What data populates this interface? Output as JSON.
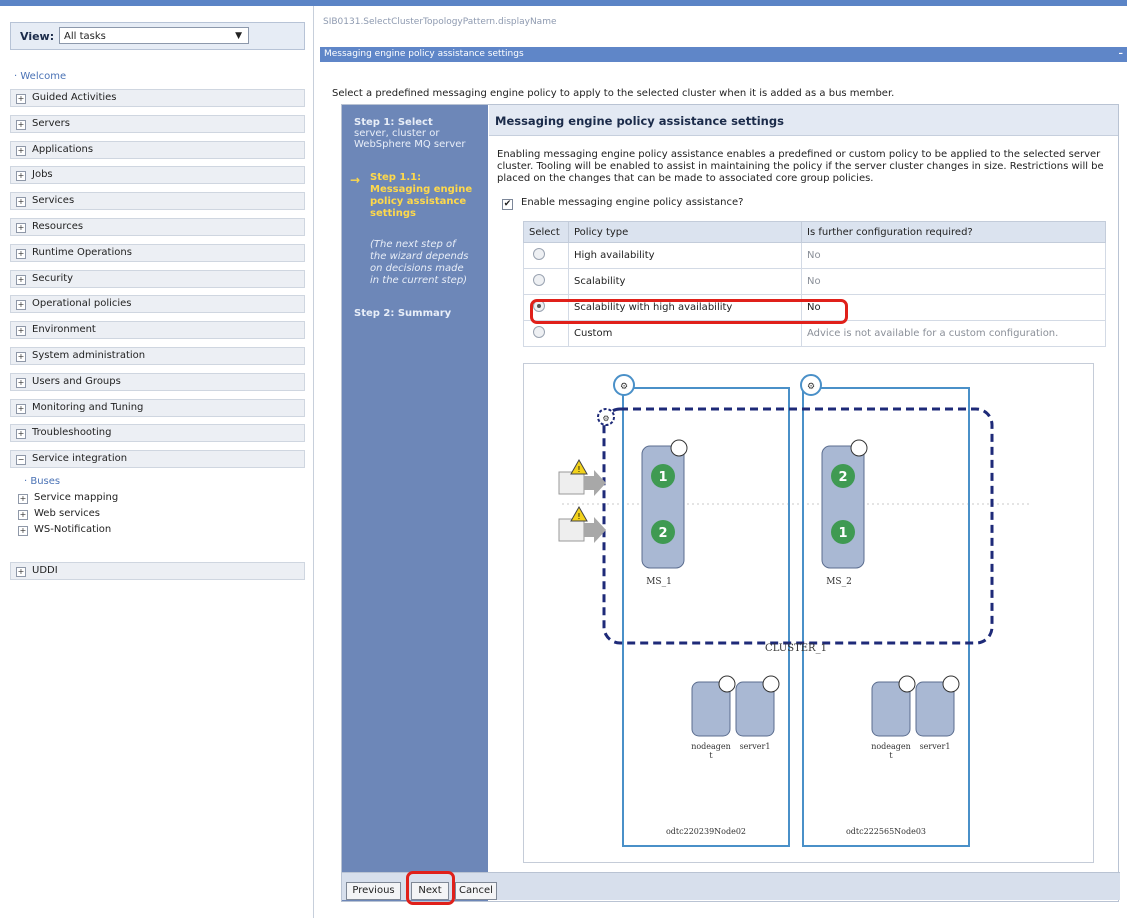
{
  "nav": {
    "view_label": "View:",
    "view_value": "All tasks",
    "welcome": "Welcome",
    "items_top": [
      "Guided Activities",
      "Servers",
      "Applications",
      "Jobs",
      "Services",
      "Resources",
      "Runtime Operations",
      "Security",
      "Operational policies",
      "Environment",
      "System administration",
      "Users and Groups",
      "Monitoring and Tuning",
      "Troubleshooting",
      "Service integration"
    ],
    "service_integration_children": [
      "Buses",
      "Service mapping",
      "Web services",
      "WS-Notification"
    ],
    "item_uddi": "UDDI"
  },
  "breadcrumb": "SIB0131.SelectClusterTopologyPattern.displayName",
  "header": {
    "title": "Messaging engine policy assistance settings"
  },
  "intro": "Select a predefined messaging engine policy to apply to the selected cluster when it is added as a bus member.",
  "steps": {
    "step1_line1": "Step 1: Select",
    "step1_line2": "server, cluster or",
    "step1_line3": "WebSphere MQ server",
    "step11_line1": "Step 1.1:",
    "step11_line2": "Messaging engine",
    "step11_line3": "policy assistance",
    "step11_line4": "settings",
    "note_line1": "(The next step of",
    "note_line2": "the wizard depends",
    "note_line3": "on decisions made",
    "note_line4": "in the current step)",
    "step2": "Step 2: Summary"
  },
  "content": {
    "title": "Messaging engine policy assistance settings",
    "description": "Enabling messaging engine policy assistance enables a predefined or custom policy to be applied to the selected server cluster. Tooling will be enabled to assist in maintaining the policy if the server cluster changes in size. Restrictions will be placed on the changes that can be made to associated core group policies.",
    "enable_label": "Enable messaging engine policy assistance?",
    "enable_checked": true
  },
  "table": {
    "headers": [
      "Select",
      "Policy type",
      "Is further configuration required?"
    ],
    "rows": [
      {
        "policy": "High availability",
        "config": "No",
        "selected": false
      },
      {
        "policy": "Scalability",
        "config": "No",
        "selected": false
      },
      {
        "policy": "Scalability with high availability",
        "config": "No",
        "selected": true
      },
      {
        "policy": "Custom",
        "config": "Advice is not available for a custom configuration.",
        "selected": false
      }
    ]
  },
  "diagram": {
    "engine_left": "MS_1",
    "engine_right": "MS_2",
    "cluster_label": "CLUSTER_1",
    "node_left": "odtc220239Node02",
    "node_right": "odtc222565Node03",
    "server_agent": "nodeagen\nt",
    "server_1": "server1",
    "engine_left_slots": [
      "1",
      "2"
    ],
    "engine_right_slots": [
      "2",
      "1"
    ]
  },
  "buttons": {
    "previous": "Previous",
    "next": "Next",
    "cancel": "Cancel"
  },
  "colors": {
    "header_blue": "#5f86c8",
    "step_panel": "#6d87b8",
    "highlight_red": "#e0201a",
    "engine_green": "#3f9a52"
  }
}
